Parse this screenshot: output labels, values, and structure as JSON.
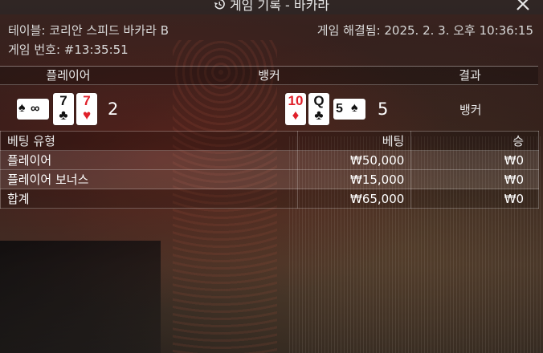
{
  "window": {
    "title": "게임 기록 - 바카라"
  },
  "info": {
    "table_label": "테이블: 코리안 스피드 바카라 B",
    "resolved_label": "게임 해결됨: 2025. 2. 3. 오후 10:36:15",
    "game_number_label": "게임 번호: #13:35:51"
  },
  "results": {
    "headers": {
      "player": "플레이어",
      "banker": "뱅커",
      "result": "결과"
    },
    "player": {
      "cards": [
        {
          "rank": "∞",
          "suit": "♠",
          "color": "#111111",
          "orientation": "sideways"
        },
        {
          "rank": "7",
          "suit": "♣",
          "color": "#111111",
          "orientation": "upright"
        },
        {
          "rank": "7",
          "suit": "♥",
          "color": "#e0202a",
          "orientation": "upright"
        }
      ],
      "score": "2"
    },
    "banker": {
      "cards": [
        {
          "rank": "10",
          "suit": "♦",
          "color": "#e0202a",
          "orientation": "upright"
        },
        {
          "rank": "Q",
          "suit": "♣",
          "color": "#111111",
          "orientation": "upright"
        },
        {
          "rank": "5",
          "suit": "♠",
          "color": "#111111",
          "orientation": "sideways"
        }
      ],
      "score": "5"
    },
    "outcome": "뱅커"
  },
  "bets": {
    "headers": {
      "type": "베팅 유형",
      "bet": "베팅",
      "win": "승"
    },
    "rows": [
      {
        "type": "플레이어",
        "bet": "₩50,000",
        "win": "₩0"
      },
      {
        "type": "플레이어 보너스",
        "bet": "₩15,000",
        "win": "₩0"
      },
      {
        "type": "합계",
        "bet": "₩65,000",
        "win": "₩0"
      }
    ]
  },
  "icons": {
    "history": "history-icon",
    "close": "close-icon"
  }
}
